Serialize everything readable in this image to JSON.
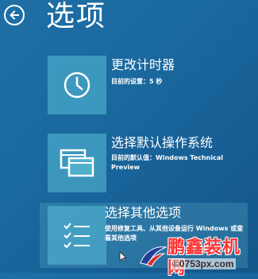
{
  "header": {
    "title": "选项",
    "back_icon": "back-arrow-icon"
  },
  "options": [
    {
      "title": "更改计时器",
      "description": "目前的设置：5 秒",
      "icon": "clock-icon"
    },
    {
      "title": "选择默认操作系统",
      "description": "目前的默认值：Windows Technical Preview",
      "icon": "windows-stack-icon"
    },
    {
      "title": "选择其他选项",
      "description": "使用修复工具、从其他设备运行 Windows 或查看其他选项",
      "icon": "checklist-icon"
    }
  ],
  "watermark": {
    "brand": "鹏鑫装机网",
    "url": "©0753px.com"
  },
  "colors": {
    "background": "#1a6aa0",
    "tile": "#5abed7",
    "text": "#ffffff",
    "watermark_red": "#ff3333"
  }
}
